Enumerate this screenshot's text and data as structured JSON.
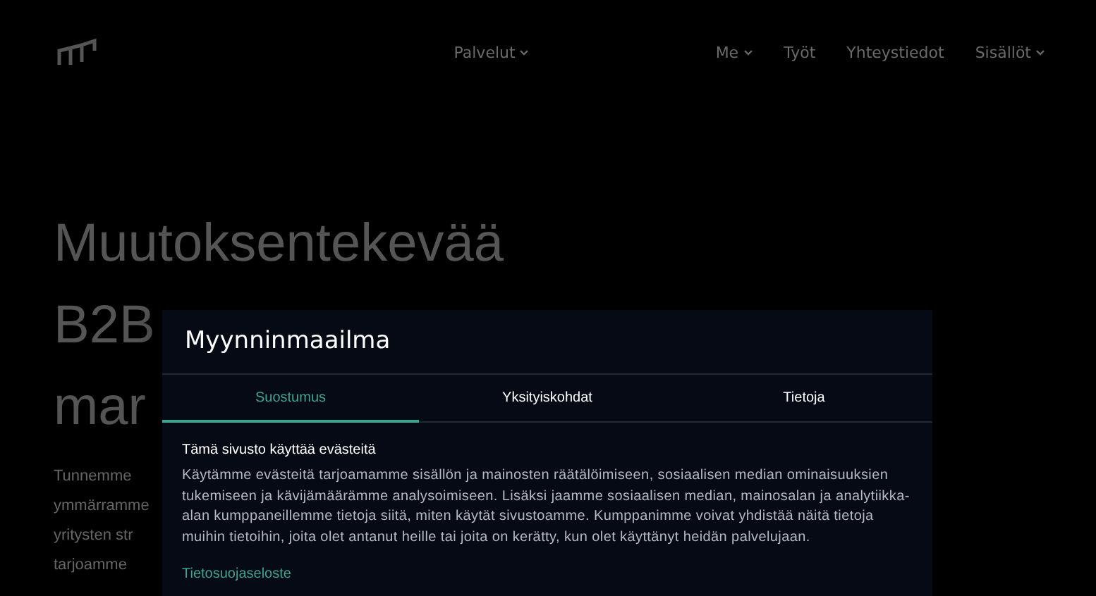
{
  "nav": {
    "items": [
      {
        "label": "Palvelut",
        "has_menu": true
      },
      {
        "label": "Me",
        "has_menu": true
      },
      {
        "label": "Työt",
        "has_menu": false
      },
      {
        "label": "Yhteystiedot",
        "has_menu": false
      },
      {
        "label": "Sisällöt",
        "has_menu": true
      }
    ]
  },
  "hero": {
    "title_lines": [
      "Muutoksentekevää",
      "B2B",
      "mar"
    ],
    "intro_lines": [
      "Tunnemme",
      "ymmärramme",
      "yritysten str",
      "tarjoamme"
    ]
  },
  "dialog": {
    "title": "Myynninmaailma",
    "tabs": [
      {
        "label": "Suostumus",
        "selected": true
      },
      {
        "label": "Yksityiskohdat",
        "selected": false
      },
      {
        "label": "Tietoja",
        "selected": false
      }
    ],
    "heading": "Tämä sivusto käyttää evästeitä",
    "body": "Käytämme evästeitä tarjoamamme sisällön ja mainosten räätälöimiseen, sosiaalisen median ominaisuuksien tukemiseen ja kävijämäärämme analysoimiseen. Lisäksi jaamme sosiaalisen median, mainosalan ja analytiikka-alan kumppaneillemme tietoja siitä, miten käytät sivustoamme. Kumppanimme voivat yhdistää näitä tietoja muihin tietoihin, joita olet antanut heille tai joita on kerätty, kun olet käyttänyt heidän palvelujaan.",
    "link": "Tietosuojaseloste"
  }
}
